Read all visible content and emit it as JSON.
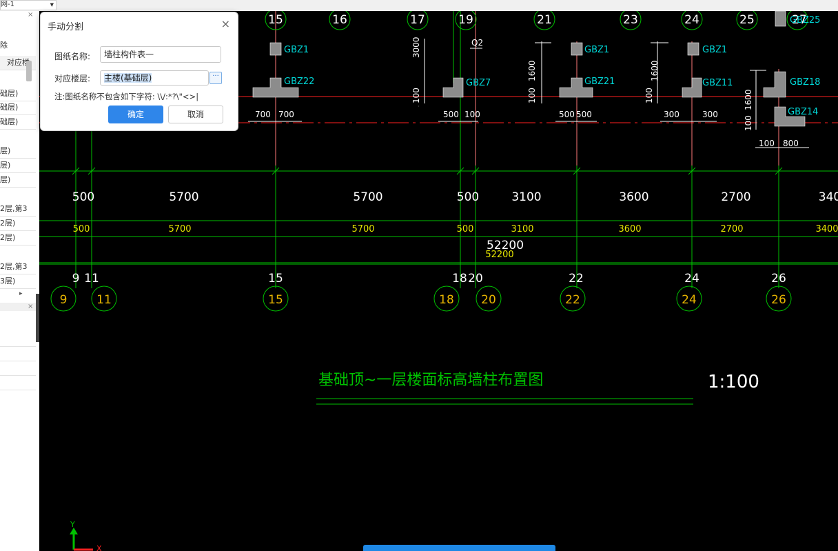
{
  "top_select": {
    "value": "网-1"
  },
  "left_panel": {
    "close_top": "×",
    "close_mid": "×",
    "items": [
      "除",
      "对应楼",
      "础层)",
      "础层)",
      "础层)",
      "层)",
      "层)",
      "层)",
      "2层,第3",
      "2层)",
      "2层)",
      "2层,第3",
      "3层)"
    ],
    "expander": "▸"
  },
  "dialog": {
    "title": "手动分割",
    "close": "×",
    "name_label": "图纸名称:",
    "name_value": "墙柱构件表一",
    "floor_label": "对应楼层:",
    "floor_value": "主楼(基础层)",
    "floor_button": "···",
    "note": "注:图纸名称不包含如下字符: \\\\/:*?\\\"<>|",
    "ok": "确定",
    "cancel": "取消"
  },
  "cad": {
    "colors": {
      "green": "#00c000",
      "yellow": "#e6e600",
      "cyan": "#00d8d8",
      "white": "#ffffff",
      "red": "#ff2020",
      "gray": "#8c8c8c",
      "pink": "#ff7a7a"
    },
    "top_axes": [
      "15",
      "16",
      "17",
      "19",
      "21",
      "23",
      "24",
      "25",
      "27"
    ],
    "top_axis_right": "GBZ25",
    "members": [
      "GBZ1",
      "GBZ22",
      "GBZ7",
      "GBZ1",
      "GBZ21",
      "GBZ1",
      "GBZ11",
      "GBZ18",
      "GBZ14"
    ],
    "vertical_dims": [
      "3000",
      "1600",
      "1600",
      "1600",
      "100",
      "100",
      "100",
      "100",
      "100"
    ],
    "q2": "Q2",
    "small_dims": [
      "700",
      "700",
      "500",
      "100",
      "500",
      "500",
      "300",
      "300",
      "100",
      "800"
    ],
    "white_dims": [
      "500",
      "5700",
      "5700",
      "500",
      "3100",
      "3600",
      "2700",
      "340"
    ],
    "yellow_dims": [
      "500",
      "5700",
      "5700",
      "500",
      "3100",
      "3600",
      "2700",
      "3400"
    ],
    "total_white": "52200",
    "total_yellow": "52200",
    "bottom_axes_white": [
      "9",
      "11",
      "15",
      "18",
      "20",
      "22",
      "24",
      "26"
    ],
    "bottom_axes_yellow": [
      "9",
      "11",
      "15",
      "18",
      "20",
      "22",
      "24",
      "26"
    ],
    "drawing_title": "基础顶~一层楼面标高墙柱布置图",
    "scale": "1:100",
    "ucs_y": "Y",
    "ucs_x": "X"
  }
}
